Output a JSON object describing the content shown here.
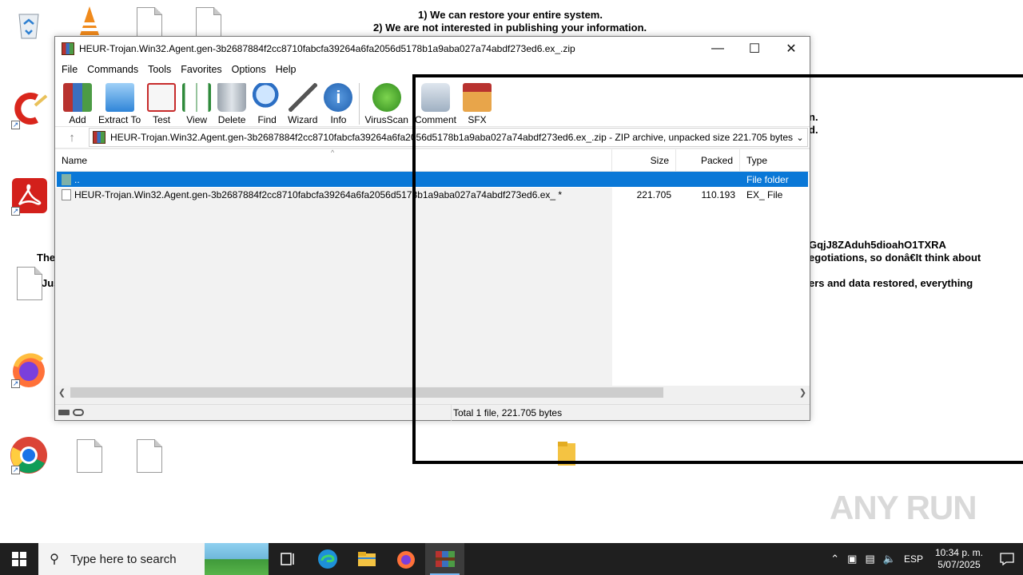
{
  "background_note": {
    "line1": "1) We can restore your entire system.",
    "line2": "2) We are not interested in publishing your information.",
    "frag_right1": "n.",
    "frag_right2": "d.",
    "frag_id": "GqjJ8ZAduh5dioahO1TXRA",
    "frag_negotiations": "egotiations, so donâ€It think about",
    "frag_restored": "ers and data restored, everything",
    "frag_the": "The",
    "frag_jus": "Jus"
  },
  "window": {
    "title": "HEUR-Trojan.Win32.Agent.gen-3b2687884f2cc8710fabcfa39264a6fa2056d5178b1a9aba027a74abdf273ed6.ex_.zip",
    "menu": [
      "File",
      "Commands",
      "Tools",
      "Favorites",
      "Options",
      "Help"
    ],
    "toolbar": [
      "Add",
      "Extract To",
      "Test",
      "View",
      "Delete",
      "Find",
      "Wizard",
      "Info",
      "VirusScan",
      "Comment",
      "SFX"
    ],
    "address": "HEUR-Trojan.Win32.Agent.gen-3b2687884f2cc8710fabcfa39264a6fa2056d5178b1a9aba027a74abdf273ed6.ex_.zip - ZIP archive, unpacked size 221.705 bytes",
    "columns": {
      "name": "Name",
      "size": "Size",
      "packed": "Packed",
      "type": "Type"
    },
    "rows": [
      {
        "name": "..",
        "size": "",
        "packed": "",
        "type": "File folder"
      },
      {
        "name": "HEUR-Trojan.Win32.Agent.gen-3b2687884f2cc8710fabcfa39264a6fa2056d5178b1a9aba027a74abdf273ed6.ex_ *",
        "size": "221.705",
        "packed": "110.193",
        "type": "EX_ File"
      }
    ],
    "status": "Total 1 file, 221.705 bytes"
  },
  "taskbar": {
    "search_placeholder": "Type here to search",
    "language": "ESP",
    "time": "10:34 p. m.",
    "date": "5/07/2025"
  },
  "watermark": "ANY RUN",
  "colors": {
    "selection": "#0a78d7",
    "taskbar": "#1f1f1f"
  }
}
